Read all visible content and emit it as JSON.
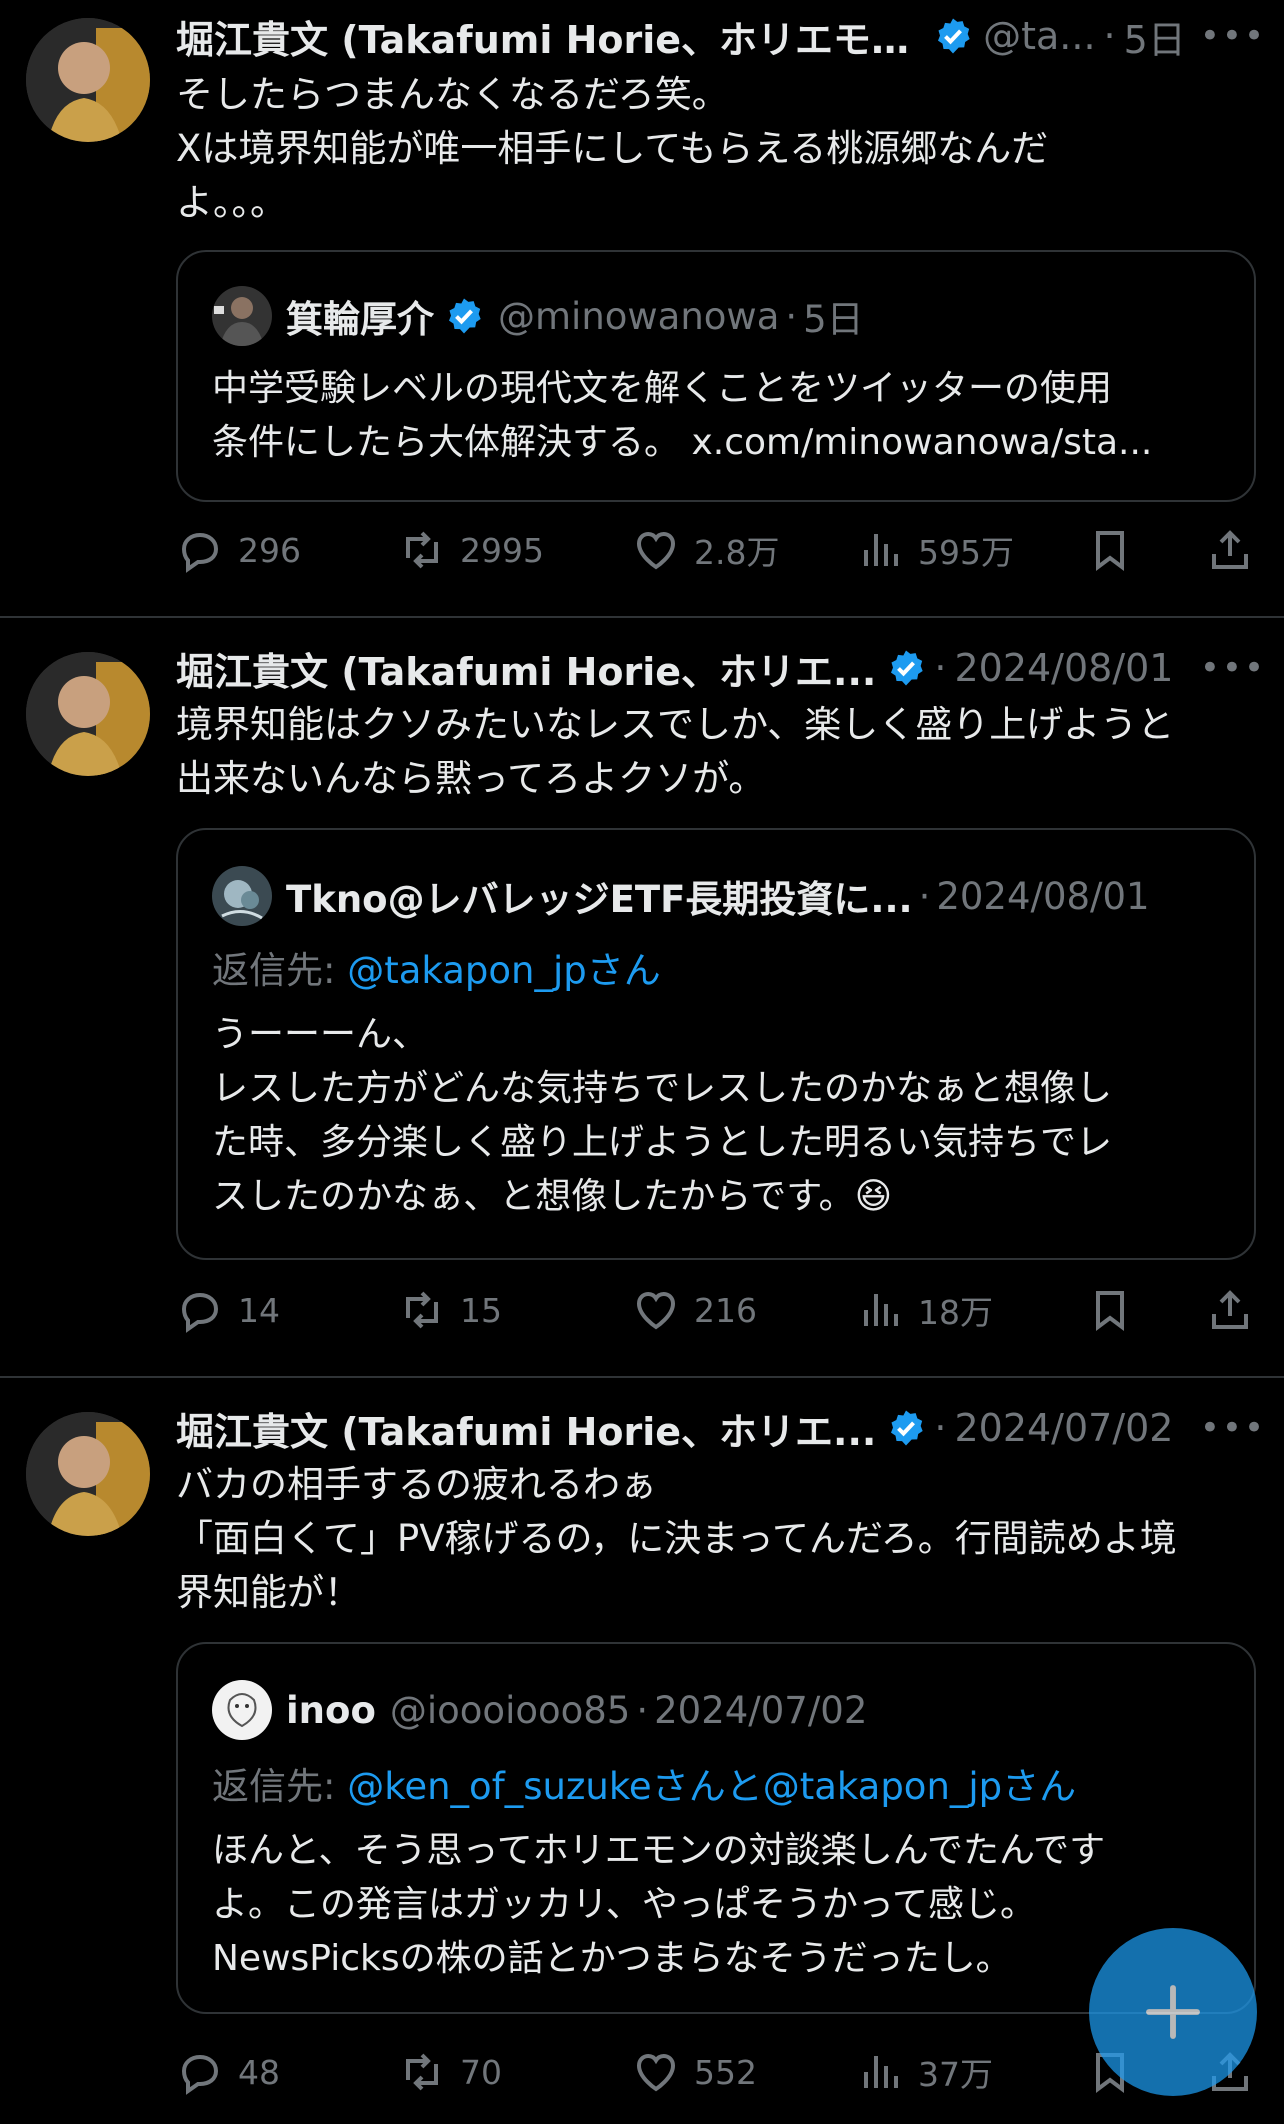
{
  "tweets": [
    {
      "author": "堀江貴文 (Takafumi Horie、ホリエモン)",
      "handle": "@ta...",
      "sep": "·",
      "time": "5日",
      "more": "•••",
      "text_lines": [
        "そしたらつまんなくなるだろ笑。",
        "Xは境界知能が唯一相手にしてもらえる桃源郷なんだ",
        "よ。。。"
      ],
      "quote": {
        "name": "箕輪厚介",
        "handle": "@minowanowa",
        "sep": "·",
        "time": "5日",
        "reply_label": "",
        "reply_mentions": "",
        "text_lines": [
          "中学受験レベルの現代文を解くことをツイッターの使用",
          "条件にしたら大体解決する。 x.com/minowanowa/sta..."
        ]
      },
      "stats": {
        "replies": "296",
        "retweets": "2995",
        "likes": "2.8万",
        "views": "595万"
      }
    },
    {
      "author": "堀江貴文 (Takafumi Horie、ホリエ...",
      "handle": "",
      "sep": "·",
      "time": "2024/08/01",
      "more": "•••",
      "text_lines": [
        "境界知能はクソみたいなレスでしか、楽しく盛り上げようと",
        "出来ないんなら黙ってろよクソが。"
      ],
      "quote": {
        "name": "Tkno@レバレッジETF長期投資に...",
        "handle": "",
        "sep": "·",
        "time": "2024/08/01",
        "reply_label": "返信先: ",
        "reply_mentions": "@takapon_jpさん",
        "text_lines": [
          "うーーーん、",
          "レスした方がどんな気持ちでレスしたのかなぁと想像し",
          "た時、多分楽しく盛り上げようとした明るい気持ちでレ",
          "スしたのかなぁ、と想像したからです。😆"
        ]
      },
      "stats": {
        "replies": "14",
        "retweets": "15",
        "likes": "216",
        "views": "18万"
      }
    },
    {
      "author": "堀江貴文 (Takafumi Horie、ホリエ...",
      "handle": "",
      "sep": "·",
      "time": "2024/07/02",
      "more": "•••",
      "text_lines": [
        "バカの相手するの疲れるわぁ",
        "「面白くて」PV稼げるの，に決まってんだろ。行間読めよ境",
        "界知能が！"
      ],
      "quote": {
        "name": "inoo",
        "handle": "@ioooiooo85",
        "sep": "·",
        "time": "2024/07/02",
        "reply_label": "返信先: ",
        "reply_mentions": "@ken_of_suzukeさんと@takapon_jpさん",
        "text_lines": [
          "ほんと、そう思ってホリエモンの対談楽しんでたんです",
          "よ。この発言はガッカリ、やっぱそうかって感じ。",
          "NewsPicksの株の話とかつまらなそうだったし。"
        ]
      },
      "stats": {
        "replies": "48",
        "retweets": "70",
        "likes": "552",
        "views": "37万"
      }
    }
  ],
  "colors": {
    "background": "#000000",
    "text": "#e7e9ea",
    "muted": "#71767b",
    "accent": "#1d9bf0",
    "border": "#2f3336"
  },
  "icons": {
    "reply": "reply-icon",
    "retweet": "retweet-icon",
    "like": "like-icon",
    "views": "views-icon",
    "bookmark": "bookmark-icon",
    "share": "share-icon",
    "verified": "verified-icon",
    "compose": "plus-icon"
  }
}
